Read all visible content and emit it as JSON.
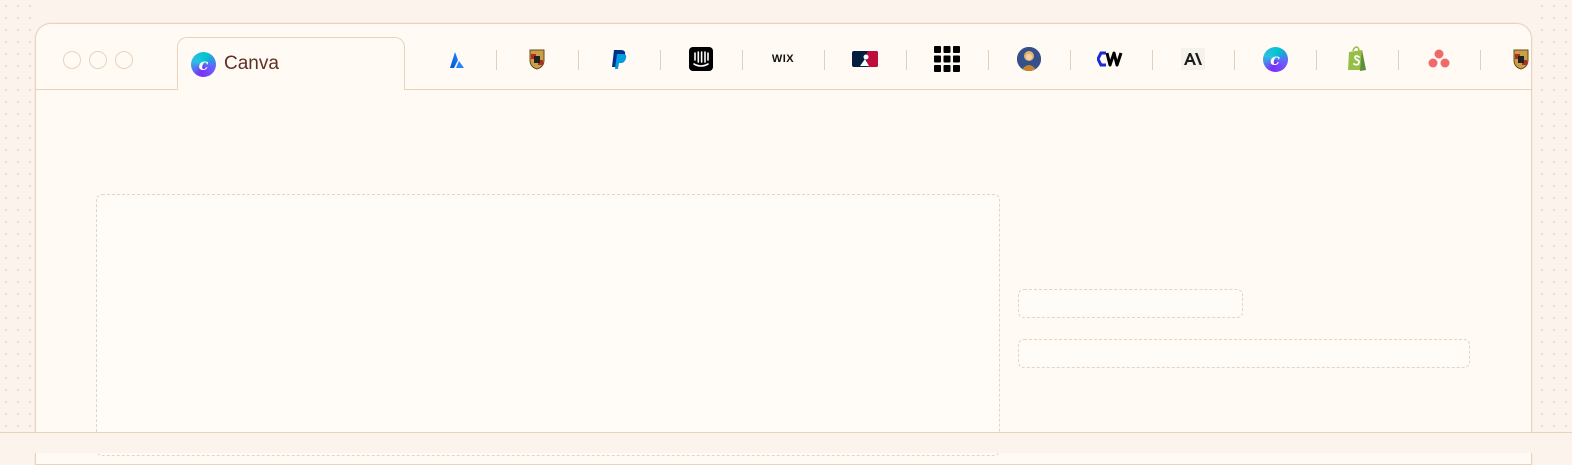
{
  "window": {
    "active_tab": {
      "label": "Canva",
      "icon": "canva-icon"
    },
    "tabs": [
      {
        "name": "atlassian-icon"
      },
      {
        "name": "porsche-icon"
      },
      {
        "name": "paypal-icon"
      },
      {
        "name": "intercom-icon"
      },
      {
        "name": "wix-icon",
        "text": "WIX"
      },
      {
        "name": "mlb-icon"
      },
      {
        "name": "grid-apps-icon"
      },
      {
        "name": "portrait-avatar-icon"
      },
      {
        "name": "coinweb-icon"
      },
      {
        "name": "anthropic-icon"
      },
      {
        "name": "canva-icon"
      },
      {
        "name": "shopify-icon"
      },
      {
        "name": "asana-icon"
      },
      {
        "name": "porsche-icon"
      }
    ]
  },
  "colors": {
    "background": "#fcf4ec",
    "window": "#fffaf4",
    "border": "#e8d3bc",
    "tab_text": "#5e3124"
  }
}
